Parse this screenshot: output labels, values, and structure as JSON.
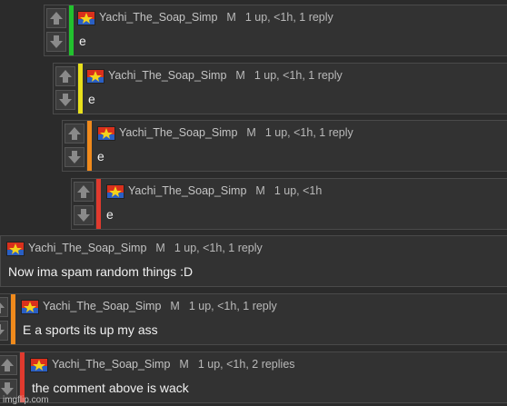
{
  "comments": [
    {
      "username": "Yachi_The_Soap_Simp",
      "badge": "M",
      "stats": "1 up, <1h, 1 reply",
      "text": "e",
      "stripe_color": "#22c22e"
    },
    {
      "username": "Yachi_The_Soap_Simp",
      "badge": "M",
      "stats": "1 up, <1h, 1 reply",
      "text": "e",
      "stripe_color": "#e8e01c"
    },
    {
      "username": "Yachi_The_Soap_Simp",
      "badge": "M",
      "stats": "1 up, <1h, 1 reply",
      "text": "e",
      "stripe_color": "#f08a1c"
    },
    {
      "username": "Yachi_The_Soap_Simp",
      "badge": "M",
      "stats": "1 up, <1h",
      "text": "e",
      "stripe_color": "#e03a2e"
    },
    {
      "username": "Yachi_The_Soap_Simp",
      "badge": "M",
      "stats": "1 up, <1h, 1 reply",
      "text": "Now ima spam random things :D",
      "stripe_color": ""
    },
    {
      "username": "Yachi_The_Soap_Simp",
      "badge": "M",
      "stats": "1 up, <1h, 1 reply",
      "text": "E a sports its up my ass",
      "stripe_color": "#f08a1c"
    },
    {
      "username": "Yachi_The_Soap_Simp",
      "badge": "M",
      "stats": "1 up, <1h, 2 replies",
      "text": "the comment above is wack",
      "stripe_color": "#e03a2e"
    }
  ],
  "icons": {
    "upvote": "arrow-up-icon",
    "downvote": "arrow-down-icon",
    "avatar": "user-avatar"
  },
  "watermark": "imgflip.com"
}
